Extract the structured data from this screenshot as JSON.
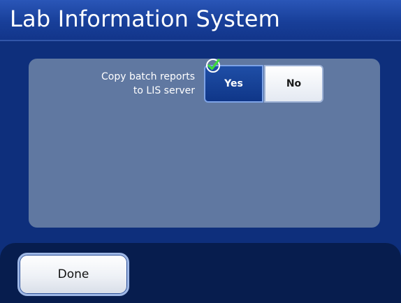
{
  "header": {
    "title": "Lab Information System"
  },
  "setting": {
    "label_line1": "Copy batch reports",
    "label_line2": "to LIS server",
    "options": [
      {
        "label": "Yes",
        "selected": true
      },
      {
        "label": "No",
        "selected": false
      }
    ]
  },
  "footer": {
    "done_label": "Done"
  },
  "colors": {
    "background": "#0e2f7c",
    "panel": "#6078a1",
    "selected_option": "#12398d",
    "check_icon": "#3ddc3d"
  },
  "icons": {
    "selected_indicator": "checkmark-icon"
  }
}
